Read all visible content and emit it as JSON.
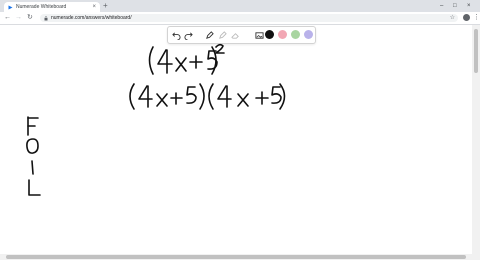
{
  "browser": {
    "tab_title": "Numerade Whiteboard",
    "tab_close": "×",
    "new_tab": "+",
    "url": "numerade.com/answers/whiteboard/",
    "minimize": "–",
    "maximize": "□",
    "close": "×",
    "back": "←",
    "forward": "→",
    "reload": "↻",
    "bookmark": "☆",
    "menu": "⋮"
  },
  "toolbar": {
    "tools": [
      "undo-icon",
      "redo-icon",
      "pen-icon",
      "highlighter-icon",
      "eraser-icon",
      "image-icon"
    ],
    "colors": [
      "#111111",
      "#f2a7b4",
      "#a9d5a1",
      "#b9b2ea"
    ]
  },
  "whiteboard": {
    "lines": [
      "(4x+5)^2",
      "(4x+5)(4x+5)",
      "F",
      "O",
      "I",
      "L"
    ]
  }
}
